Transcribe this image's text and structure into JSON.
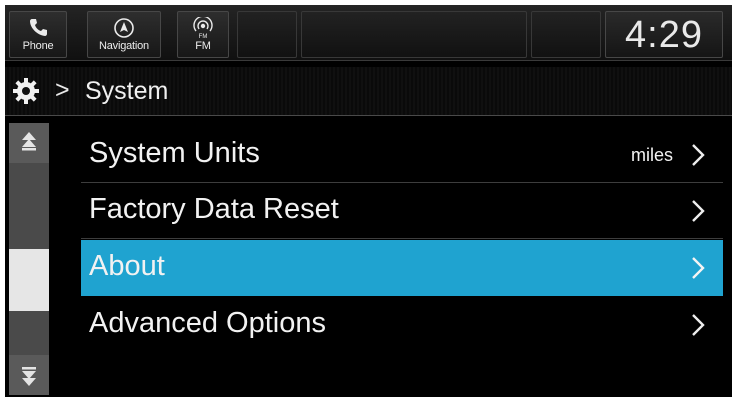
{
  "topbar": {
    "phone_label": "Phone",
    "nav_label": "Navigation",
    "fm_label": "FM",
    "fm_icon_text": "FM",
    "clock": "4:29"
  },
  "breadcrumb": {
    "separator": ">",
    "title": "System"
  },
  "menu": {
    "items": [
      {
        "label": "System Units",
        "value": "miles",
        "selected": false
      },
      {
        "label": "Factory Data Reset",
        "value": "",
        "selected": false
      },
      {
        "label": "About",
        "value": "",
        "selected": true
      },
      {
        "label": "Advanced Options",
        "value": "",
        "selected": false
      }
    ]
  },
  "colors": {
    "selected_row": "#1fa3d0",
    "background": "#000000",
    "text": "#f2f2f2"
  }
}
